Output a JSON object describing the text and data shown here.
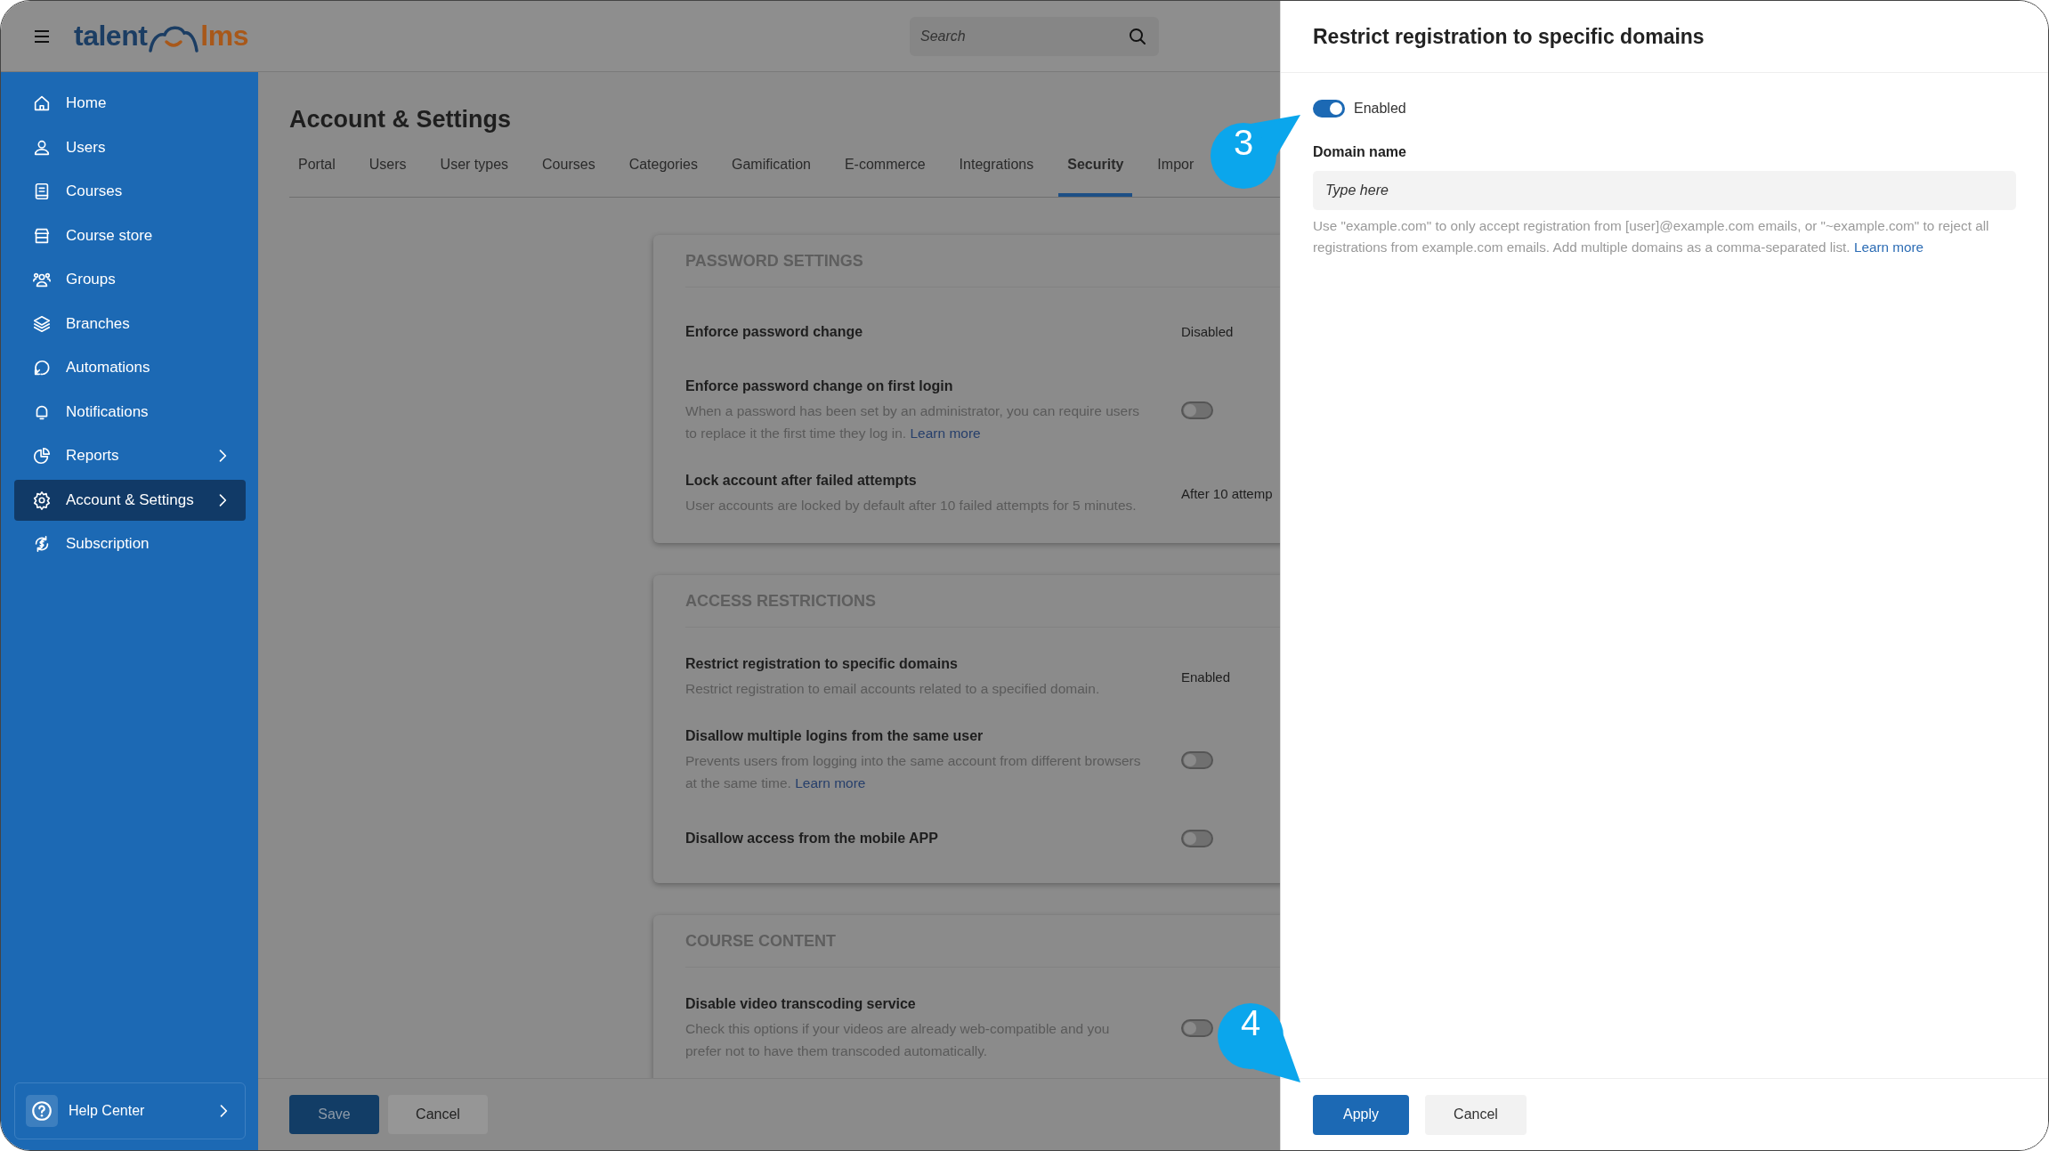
{
  "header": {
    "logo": {
      "left": "talent",
      "right": "lms"
    },
    "search": {
      "placeholder": "Search"
    }
  },
  "sidebar": {
    "items": [
      {
        "label": "Home",
        "selected": false,
        "expandable": false
      },
      {
        "label": "Users",
        "selected": false,
        "expandable": false
      },
      {
        "label": "Courses",
        "selected": false,
        "expandable": false
      },
      {
        "label": "Course store",
        "selected": false,
        "expandable": false
      },
      {
        "label": "Groups",
        "selected": false,
        "expandable": false
      },
      {
        "label": "Branches",
        "selected": false,
        "expandable": false
      },
      {
        "label": "Automations",
        "selected": false,
        "expandable": false
      },
      {
        "label": "Notifications",
        "selected": false,
        "expandable": false
      },
      {
        "label": "Reports",
        "selected": false,
        "expandable": true
      },
      {
        "label": "Account & Settings",
        "selected": true,
        "expandable": true
      },
      {
        "label": "Subscription",
        "selected": false,
        "expandable": false
      }
    ],
    "help": {
      "label": "Help Center",
      "expandable": true
    }
  },
  "page": {
    "title": "Account & Settings",
    "tabs": [
      {
        "label": "Portal",
        "selected": false
      },
      {
        "label": "Users",
        "selected": false
      },
      {
        "label": "User types",
        "selected": false
      },
      {
        "label": "Courses",
        "selected": false
      },
      {
        "label": "Categories",
        "selected": false
      },
      {
        "label": "Gamification",
        "selected": false
      },
      {
        "label": "E-commerce",
        "selected": false
      },
      {
        "label": "Integrations",
        "selected": false
      },
      {
        "label": "Security",
        "selected": true
      },
      {
        "label": "Impor",
        "selected": false
      }
    ],
    "sections": [
      {
        "title": "PASSWORD SETTINGS",
        "rows": [
          {
            "kind": "value",
            "title": "Enforce password change",
            "value": "Disabled"
          },
          {
            "kind": "toggle",
            "title": "Enforce password change on first login",
            "description": "When a password has been set by an administrator, you can require users to replace it the first time they log in.",
            "link": "Learn more",
            "on": false
          },
          {
            "kind": "value",
            "title": "Lock account after failed attempts",
            "description": "User accounts are locked by default after 10 failed attempts for 5 minutes.",
            "value": "After 10 attemp"
          }
        ]
      },
      {
        "title": "ACCESS RESTRICTIONS",
        "rows": [
          {
            "kind": "value",
            "title": "Restrict registration to specific domains",
            "description": "Restrict registration to email accounts related to a specified domain.",
            "value": "Enabled"
          },
          {
            "kind": "toggle",
            "title": "Disallow multiple logins from the same user",
            "description": "Prevents users from logging into the same account from different browsers at the same time.",
            "link": "Learn more",
            "on": false
          },
          {
            "kind": "toggle",
            "title": "Disallow access from the mobile APP",
            "on": false
          }
        ]
      },
      {
        "title": "COURSE CONTENT",
        "rows": [
          {
            "kind": "toggle",
            "title": "Disable video transcoding service",
            "description": "Check this options if your videos are already web-compatible and you prefer not to have them transcoded automatically.",
            "on": false
          }
        ]
      }
    ],
    "buttons": {
      "save": "Save",
      "cancel": "Cancel"
    }
  },
  "drawer": {
    "title": "Restrict registration to specific domains",
    "toggle": {
      "label": "Enabled",
      "on": true
    },
    "field": {
      "label": "Domain name",
      "placeholder": "Type here"
    },
    "help": "Use \"example.com\" to only accept registration from [user]@example.com emails, or \"~example.com\" to reject all registrations from example.com emails. Add multiple domains as a comma-separated list.",
    "help_link": "Learn more",
    "buttons": {
      "apply": "Apply",
      "cancel": "Cancel"
    }
  },
  "callouts": [
    {
      "number": "3"
    },
    {
      "number": "4"
    }
  ]
}
